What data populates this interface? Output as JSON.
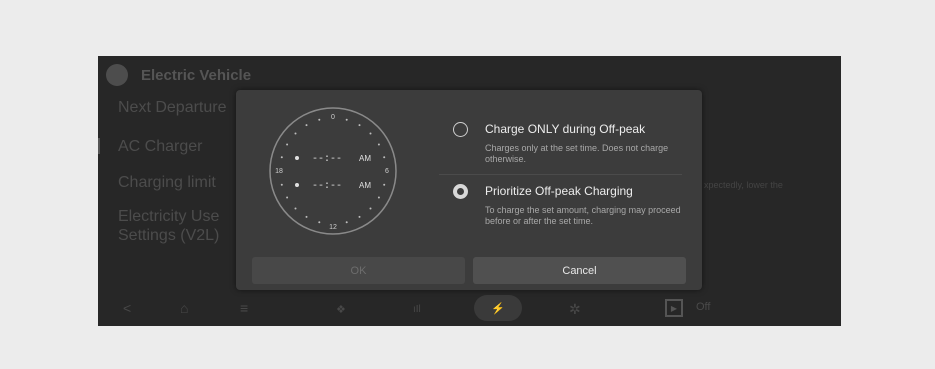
{
  "app": {
    "title": "Electric Vehicle",
    "menu": [
      "Next Departure",
      "AC Charger",
      "Charging limit",
      "Electricity Use",
      "Settings (V2L)"
    ],
    "side_text": "xpectedly, lower the"
  },
  "clock": {
    "hour_labels": {
      "top": "0",
      "right": "6",
      "bottom": "12",
      "left": "18"
    },
    "start_time": "--:--",
    "start_ampm": "AM",
    "end_time": "--:--",
    "end_ampm": "AM"
  },
  "options": [
    {
      "label": "Charge ONLY during Off-peak",
      "description": "Charges only at the set time. Does not charge otherwise.",
      "selected": false
    },
    {
      "label": "Prioritize Off-peak Charging",
      "description": "To charge the set amount, charging may proceed before or after the set time.",
      "selected": true
    }
  ],
  "buttons": {
    "ok": "OK",
    "cancel": "Cancel"
  },
  "bottom_bar": {
    "icons": [
      "back-icon",
      "home-icon",
      "menu-icon",
      "fan-icon",
      "equalizer-icon",
      "charging-icon",
      "settings-icon",
      "media-play-icon"
    ],
    "back_glyph": "<",
    "home_glyph": "⌂",
    "menu_glyph": "≡",
    "fan_glyph": "❖",
    "eq_glyph": "ıIl",
    "charge_glyph": "⚡",
    "settings_glyph": "✲",
    "play_glyph": "▶",
    "media_label": "Off"
  }
}
